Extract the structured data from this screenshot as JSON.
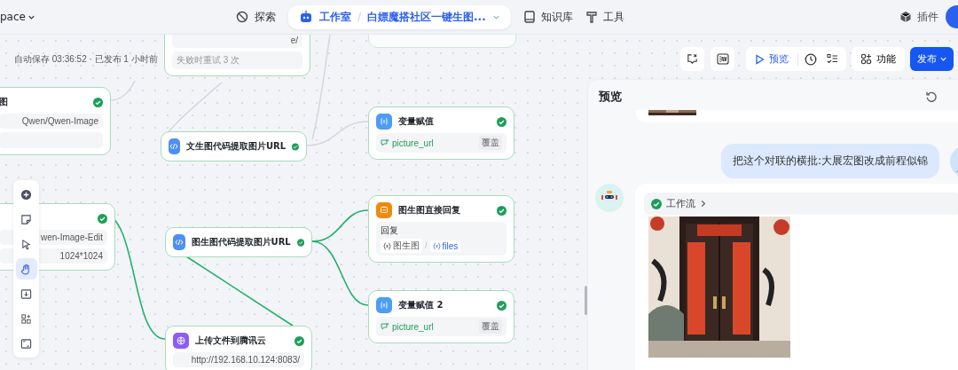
{
  "top_nav": {
    "workspace": "pace",
    "items": [
      {
        "label": "探索"
      },
      {
        "label": "知识库"
      },
      {
        "label": "工具"
      }
    ],
    "studio": {
      "section": "工作室",
      "separator": "/",
      "title": "白嫖魔搭社区一键生图..."
    },
    "plugins": "插件"
  },
  "autosave": "自动保存 03:36:52 · 已发布 1 小时前",
  "toolbar": {
    "preview": "预览",
    "features": "功能",
    "publish": "发布"
  },
  "canvas_tools": [
    {
      "selected": false
    },
    {
      "selected": false
    },
    {
      "selected": false
    },
    {
      "selected": true
    },
    {
      "selected": false
    },
    {
      "selected": false
    },
    {
      "selected": false
    }
  ],
  "nodes": [
    {
      "title": "图",
      "done": true,
      "rows": [
        {
          "kind": "text",
          "text": "Qwen/Qwen-Image"
        },
        {
          "kind": "empty"
        }
      ]
    },
    {
      "done": false,
      "rows": [
        {
          "kind": "text",
          "text": "e/"
        },
        {
          "kind": "note",
          "text": "失败时重试 3 次"
        }
      ]
    },
    {
      "title": "文生图代码提取图片URL",
      "kind": "code",
      "done": true
    },
    {
      "title": "变量赋值",
      "kind": "variable",
      "done": true,
      "rows": [
        {
          "kind": "variable",
          "name": "picture_url",
          "tag": "覆盖"
        }
      ]
    },
    {
      "done": true,
      "rows": [
        {
          "kind": "text",
          "text": "wen-Image-Edit"
        },
        {
          "kind": "text",
          "text": "1024*1024"
        }
      ]
    },
    {
      "title": "图生图代码提取图片URL",
      "kind": "code",
      "done": true
    },
    {
      "title": "图生图直接回复",
      "kind": "reply",
      "done": true,
      "rows": [
        {
          "kind": "reply",
          "label": "回复",
          "chips": [
            "图生图",
            "files"
          ],
          "separator": "/"
        }
      ]
    },
    {
      "title": "变量赋值 2",
      "kind": "variable",
      "done": true,
      "rows": [
        {
          "kind": "variable",
          "name": "picture_url",
          "tag": "覆盖"
        }
      ]
    },
    {
      "title": "上传文件到腾讯云",
      "kind": "http",
      "done": true,
      "rows": [
        {
          "kind": "text",
          "text": "http://192.168.10.124:8083/"
        }
      ]
    }
  ],
  "preview": {
    "title": "预览",
    "user_message": "把这个对联的横批:大展宏图改成前程似锦",
    "workflow_label": "工作流",
    "workflow_done": true
  }
}
